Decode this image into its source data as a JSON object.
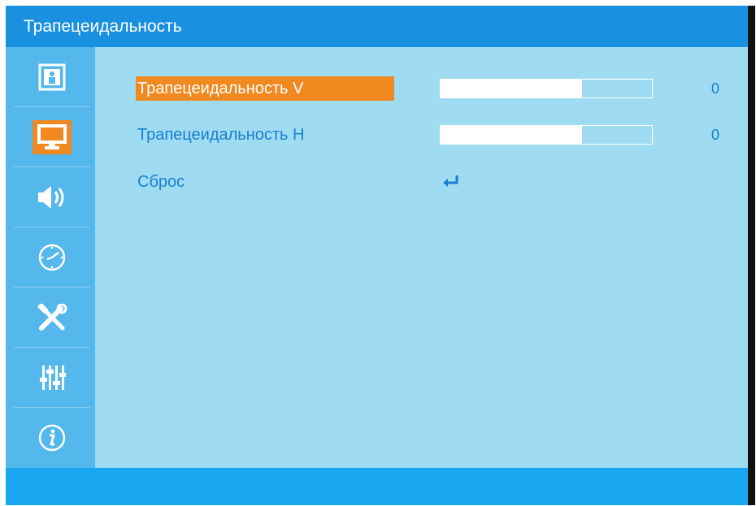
{
  "header": {
    "title": "Трапецеидальность"
  },
  "sidebar": {
    "items": [
      {
        "icon": "picture-person-icon",
        "active": false
      },
      {
        "icon": "monitor-icon",
        "active": true
      },
      {
        "icon": "speaker-icon",
        "active": false
      },
      {
        "icon": "clock-icon",
        "active": false
      },
      {
        "icon": "tools-icon",
        "active": false
      },
      {
        "icon": "equalizer-sliders-icon",
        "active": false
      },
      {
        "icon": "info-icon",
        "active": false
      }
    ]
  },
  "main": {
    "rows": [
      {
        "label": "Трапецеидальность V",
        "value": "0",
        "level": 0.67,
        "selected": true
      },
      {
        "label": "Трапецеидальность H",
        "value": "0",
        "level": 0.67,
        "selected": false
      },
      {
        "label": "Сброс",
        "icon": "enter-return-icon"
      }
    ]
  },
  "colors": {
    "title_bar": "#1a90e0",
    "sidebar": "#55b8ec",
    "content": "#9fdcf2",
    "accent_selected": "#f08a20",
    "text": "#1a7fd0",
    "bottom_bar": "#1aa6f0"
  }
}
